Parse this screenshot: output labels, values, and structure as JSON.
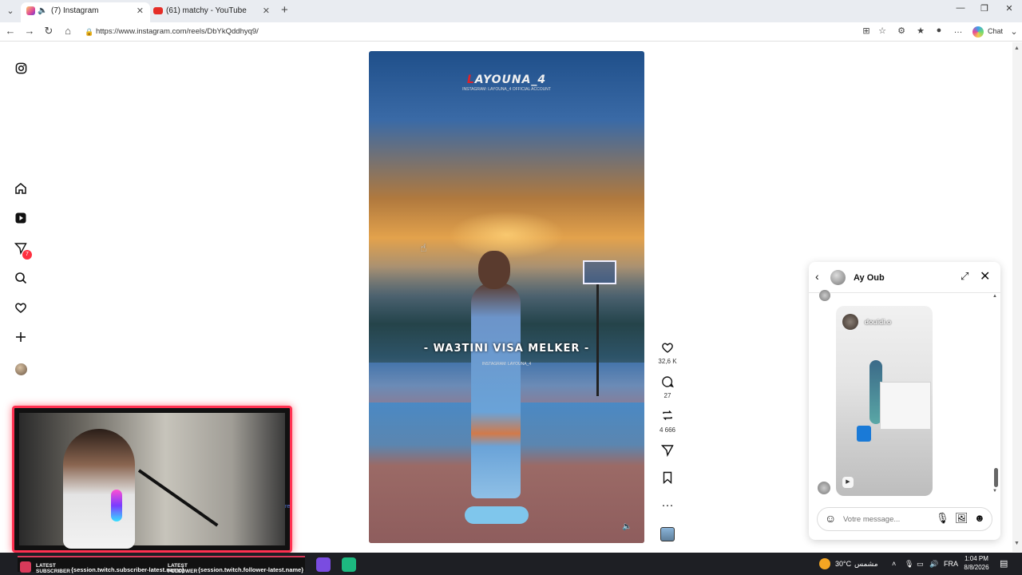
{
  "browser": {
    "tabs": [
      {
        "title": "(7) Instagram",
        "active": true
      },
      {
        "title": "(61) matchy - YouTube",
        "active": false
      }
    ],
    "url": "https://www.instagram.com/reels/DbYkQddhyq9/",
    "chat_label": "Chat"
  },
  "sidebar": {
    "notification_count": "7"
  },
  "reel": {
    "watermark_first": "L",
    "watermark_rest": "AYOUNA_4",
    "watermark_sub": "INSTAGRAM: LAYOUNA_4 OFFICIAL ACCOUNT",
    "caption": "- WA3TINI VISA MELKER -",
    "caption_sub": "INSTAGRAM: LAYOUNA_4",
    "likes": "32,6 K",
    "comments": "27",
    "reposts": "4 666"
  },
  "dm": {
    "contact_name": "Ay Oub",
    "story_user": "douidi.o",
    "input_placeholder": "Votre message..."
  },
  "stream_overlay": {
    "chat_fragment": "re",
    "alert_label_1": "LATEST SUBSCRIBER",
    "alert_value_1": "{session.twitch.subscriber-latest.name}",
    "alert_label_2": "LATEST FOLLOWER",
    "alert_value_2": "{session.twitch.follower-latest.name}"
  },
  "taskbar": {
    "weather": "30°C",
    "weather_desc": "مشمس",
    "language": "FRA",
    "time": "1:04 PM",
    "date": "8/8/2026"
  }
}
